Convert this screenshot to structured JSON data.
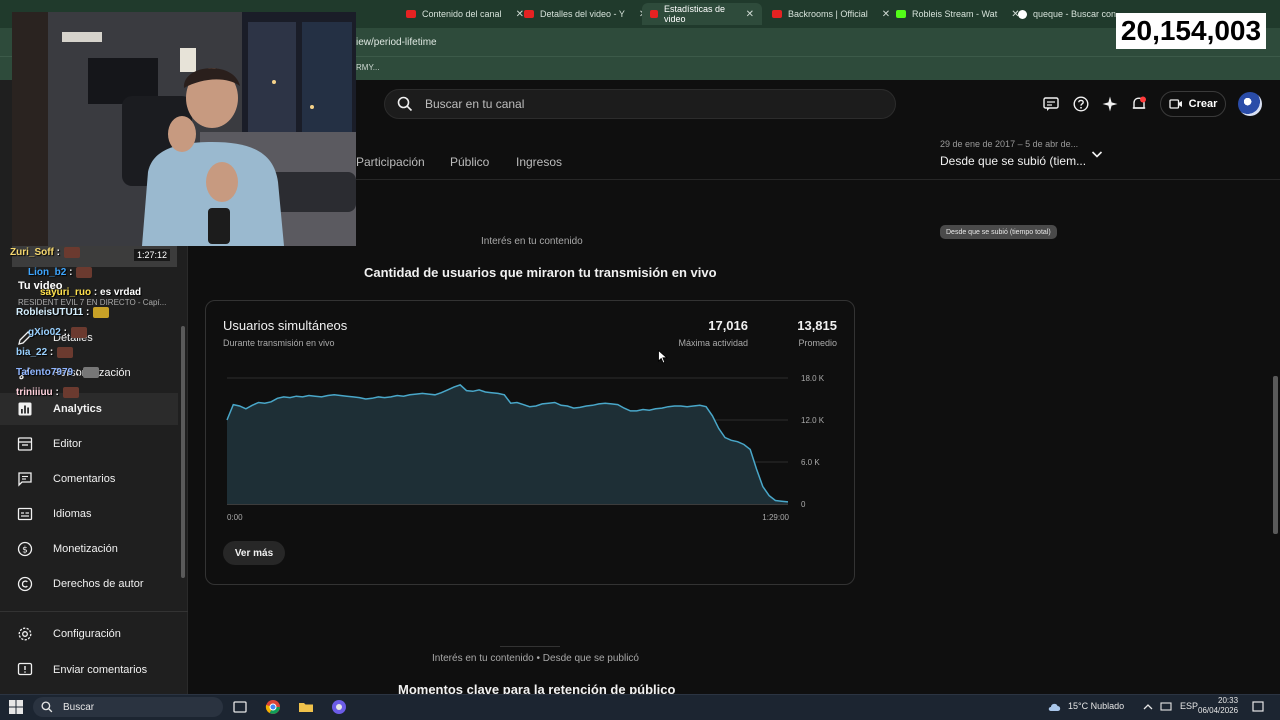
{
  "browser": {
    "tabs": [
      {
        "label": "Contenido del canal",
        "icon": "youtube-icon"
      },
      {
        "label": "Detalles del video - Y",
        "icon": "youtube-icon"
      },
      {
        "label": "Estadísticas de video",
        "icon": "youtube-icon"
      },
      {
        "label": "Backrooms | Official",
        "icon": "youtube-icon"
      },
      {
        "label": "Robleis Stream - Wat",
        "icon": "kick-icon"
      },
      {
        "label": "queque - Buscar con",
        "icon": "google-icon"
      }
    ],
    "url_fragment": "iew/period-lifetime",
    "bookmark_fragment": "RMY..."
  },
  "overlay": {
    "counter": "20,154,003"
  },
  "header": {
    "search_placeholder": "Buscar en tu canal",
    "create_label": "Crear"
  },
  "top_tabs": [
    "Participación",
    "Público",
    "Ingresos"
  ],
  "date_range": {
    "range": "29 de ene de 2017 – 5 de abr de...",
    "label": "Desde que se subió (tiem..."
  },
  "sidebar": {
    "video_title": "Tu video",
    "video_subtitle": "RESIDENT EVIL 7 EN DIRECTO - Capí...",
    "video_duration": "1:27:12",
    "items": [
      {
        "label": "Detalles",
        "icon": "pencil-icon"
      },
      {
        "label": "Personalización",
        "icon": "brush-icon"
      },
      {
        "label": "Analytics",
        "icon": "analytics-icon"
      },
      {
        "label": "Editor",
        "icon": "editor-icon"
      },
      {
        "label": "Comentarios",
        "icon": "comment-icon"
      },
      {
        "label": "Idiomas",
        "icon": "subtitles-icon"
      },
      {
        "label": "Monetización",
        "icon": "dollar-icon"
      },
      {
        "label": "Derechos de autor",
        "icon": "copyright-icon"
      },
      {
        "label": "Configuración",
        "icon": "gear-icon"
      },
      {
        "label": "Enviar comentarios",
        "icon": "feedback-icon"
      }
    ]
  },
  "chat": [
    {
      "user": "Zuri_Soff",
      "text": ":"
    },
    {
      "user": "Lion_b2",
      "text": ":"
    },
    {
      "user": "sayuri_ruo",
      "text": ": es vrdad"
    },
    {
      "user": "RobleisUTU11",
      "text": ":"
    },
    {
      "user": "gXio02",
      "text": ":"
    },
    {
      "user": "bia_22",
      "text": ":"
    },
    {
      "user": "Talento7979",
      "text": ":"
    },
    {
      "user": "triniiiuu",
      "text": ":"
    }
  ],
  "main": {
    "period_pill": "Desde que se subió (tiempo total)",
    "section1_label": "Interés en tu contenido",
    "section1_title": "Cantidad de usuarios que miraron tu transmisión en vivo",
    "card": {
      "title": "Usuarios simultáneos",
      "subtitle": "Durante transmisión en vivo",
      "peak_value": "17,016",
      "peak_label": "Máxima actividad",
      "avg_value": "13,815",
      "avg_label": "Promedio",
      "button": "Ver más"
    },
    "section2_label": "Interés en tu contenido • Desde que se publicó",
    "section2_title": "Momentos clave para la retención de público"
  },
  "chart_data": {
    "type": "area",
    "title": "Usuarios simultáneos",
    "x_tick_labels": [
      "0:00",
      "1:29:00"
    ],
    "y_ticks": [
      "0",
      "6.0 K",
      "12.0 K",
      "18.0 K"
    ],
    "ylim": [
      0,
      18000
    ],
    "xlim_minutes": [
      0,
      89
    ],
    "x_minutes": [
      0,
      1,
      2,
      3,
      4,
      5,
      6,
      7,
      8,
      9,
      10,
      11,
      12,
      13,
      14,
      15,
      16,
      17,
      18,
      19,
      20,
      21,
      22,
      23,
      24,
      25,
      26,
      27,
      28,
      29,
      30,
      31,
      32,
      33,
      34,
      35,
      36,
      37,
      38,
      39,
      40,
      41,
      42,
      43,
      44,
      45,
      46,
      47,
      48,
      49,
      50,
      51,
      52,
      53,
      54,
      55,
      56,
      57,
      58,
      59,
      60,
      61,
      62,
      63,
      64,
      65,
      66,
      67,
      68,
      69,
      70,
      71,
      72,
      73,
      74,
      75,
      76,
      77,
      78,
      79,
      80,
      81,
      82,
      83,
      84,
      85,
      86,
      87,
      88,
      89
    ],
    "values": [
      12000,
      14200,
      14000,
      13600,
      14100,
      14500,
      14400,
      14600,
      15100,
      15300,
      15200,
      15400,
      15300,
      15500,
      15400,
      15300,
      15500,
      15600,
      15500,
      15400,
      15300,
      15200,
      15000,
      15100,
      15300,
      15200,
      15300,
      15500,
      15400,
      15600,
      15700,
      15800,
      15700,
      15600,
      15900,
      16300,
      16700,
      17016,
      16200,
      16100,
      16300,
      16000,
      15900,
      15800,
      15600,
      14400,
      14500,
      14200,
      13900,
      14000,
      14300,
      14400,
      14500,
      14100,
      14000,
      13700,
      13800,
      14000,
      14100,
      14300,
      14400,
      14300,
      14200,
      13700,
      13300,
      13300,
      13500,
      13400,
      13600,
      13700,
      13900,
      14000,
      14000,
      13900,
      14000,
      14100,
      13900,
      12600,
      10800,
      9500,
      9100,
      8900,
      8500,
      7800,
      5000,
      2500,
      1200,
      500,
      400,
      300
    ],
    "grid": true
  },
  "taskbar": {
    "search_label": "Buscar",
    "weather": "15°C  Nublado",
    "lang": "ESP",
    "time": "20:33",
    "date": "06/04/2026"
  }
}
